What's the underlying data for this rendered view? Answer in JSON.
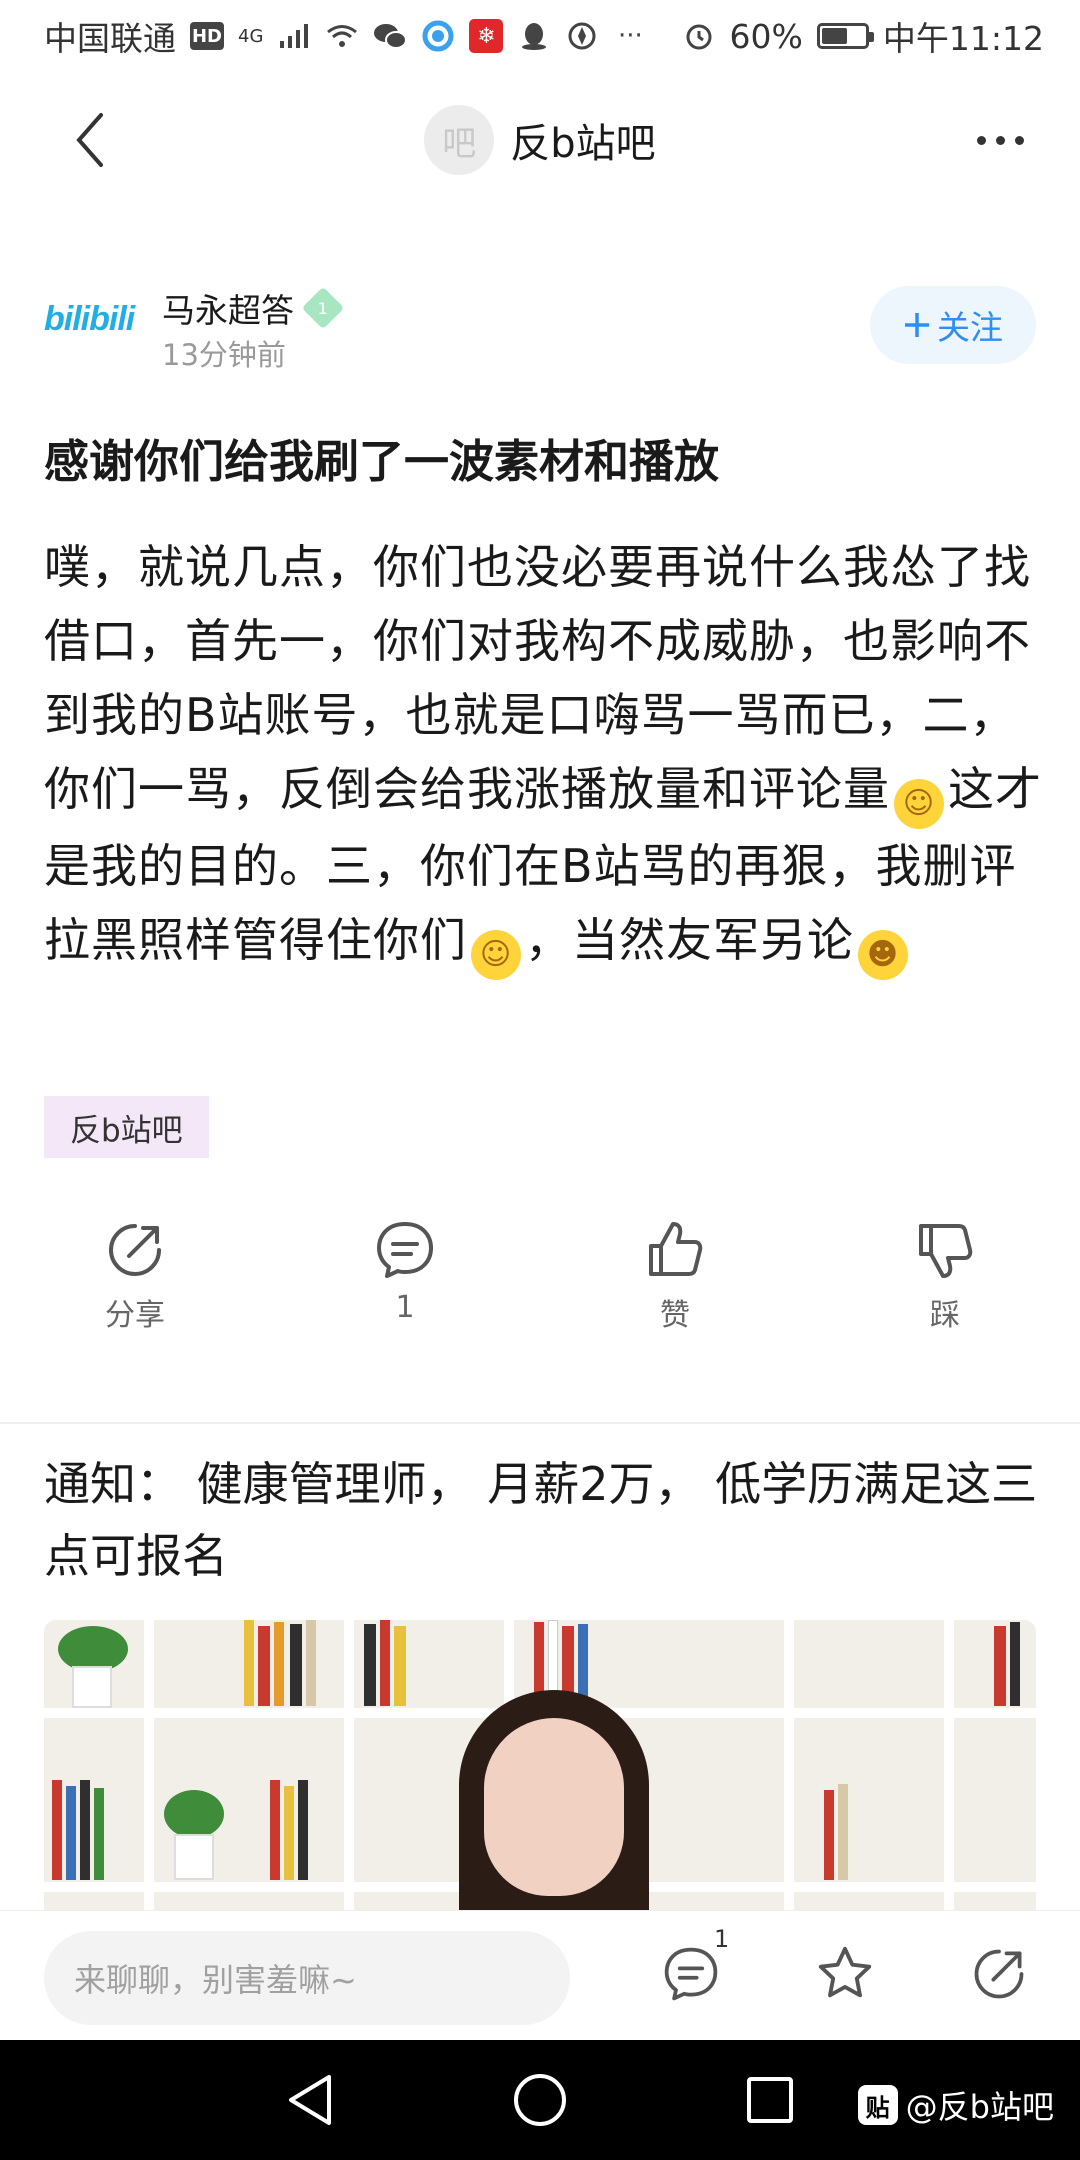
{
  "status_bar": {
    "carrier": "中国联通",
    "hd": "HD",
    "network": "4G",
    "battery": "60%",
    "battery_level": 0.6,
    "time": "中午11:12"
  },
  "header": {
    "forum_avatar": "吧",
    "forum_name": "反b站吧"
  },
  "author": {
    "logo_text": "bilibili",
    "name": "马永超答",
    "level": "1",
    "time_ago": "13分钟前",
    "follow_label": "关注"
  },
  "post": {
    "title": "感谢你们给我刷了一波素材和播放",
    "body_1": "噗，就说几点，你们也没必要再说什么我怂了找借口，首先一，你们对我构不成威胁，也影响不到我的B站账号，也就是口嗨骂一骂而已，二，你们一骂，反倒会给我涨播放量和评论量",
    "body_2": "这才是我的目的。三，你们在B站骂的再狠，我删评拉黑照样管得住你们",
    "body_3": "，当然友军另论",
    "tag": "反b站吧"
  },
  "actions": {
    "share": "分享",
    "comment": "1",
    "like": "赞",
    "dislike": "踩"
  },
  "ad": {
    "title": "通知：  健康管理师，  月薪2万，  低学历满足这三点可报名"
  },
  "bottom_bar": {
    "placeholder": "来聊聊，别害羞嘛~",
    "comment_count": "1"
  },
  "watermark": {
    "logo": "贴",
    "text": "@反b站吧"
  }
}
